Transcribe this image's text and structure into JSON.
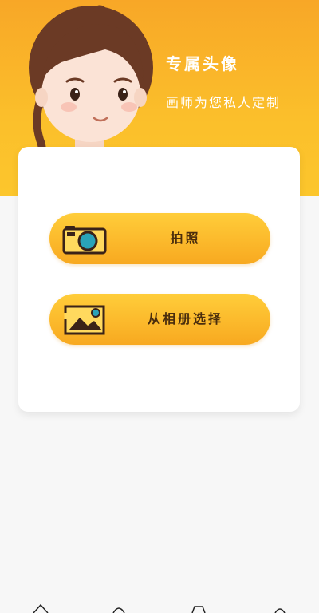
{
  "header": {
    "title": "专属头像",
    "subtitle": "画师为您私人定制",
    "avatar_icon": "girl-portrait-illustration",
    "background_color": "#f8a727"
  },
  "actions": [
    {
      "label": "拍照",
      "icon": "camera-icon"
    },
    {
      "label": "从相册选择",
      "icon": "image-gallery-icon"
    }
  ],
  "colors": {
    "button_gradient_start": "#ffcd3a",
    "button_gradient_end": "#f8a920",
    "button_text": "#4a2d0d",
    "page_background": "#f7f7f7",
    "card_background": "#ffffff"
  }
}
